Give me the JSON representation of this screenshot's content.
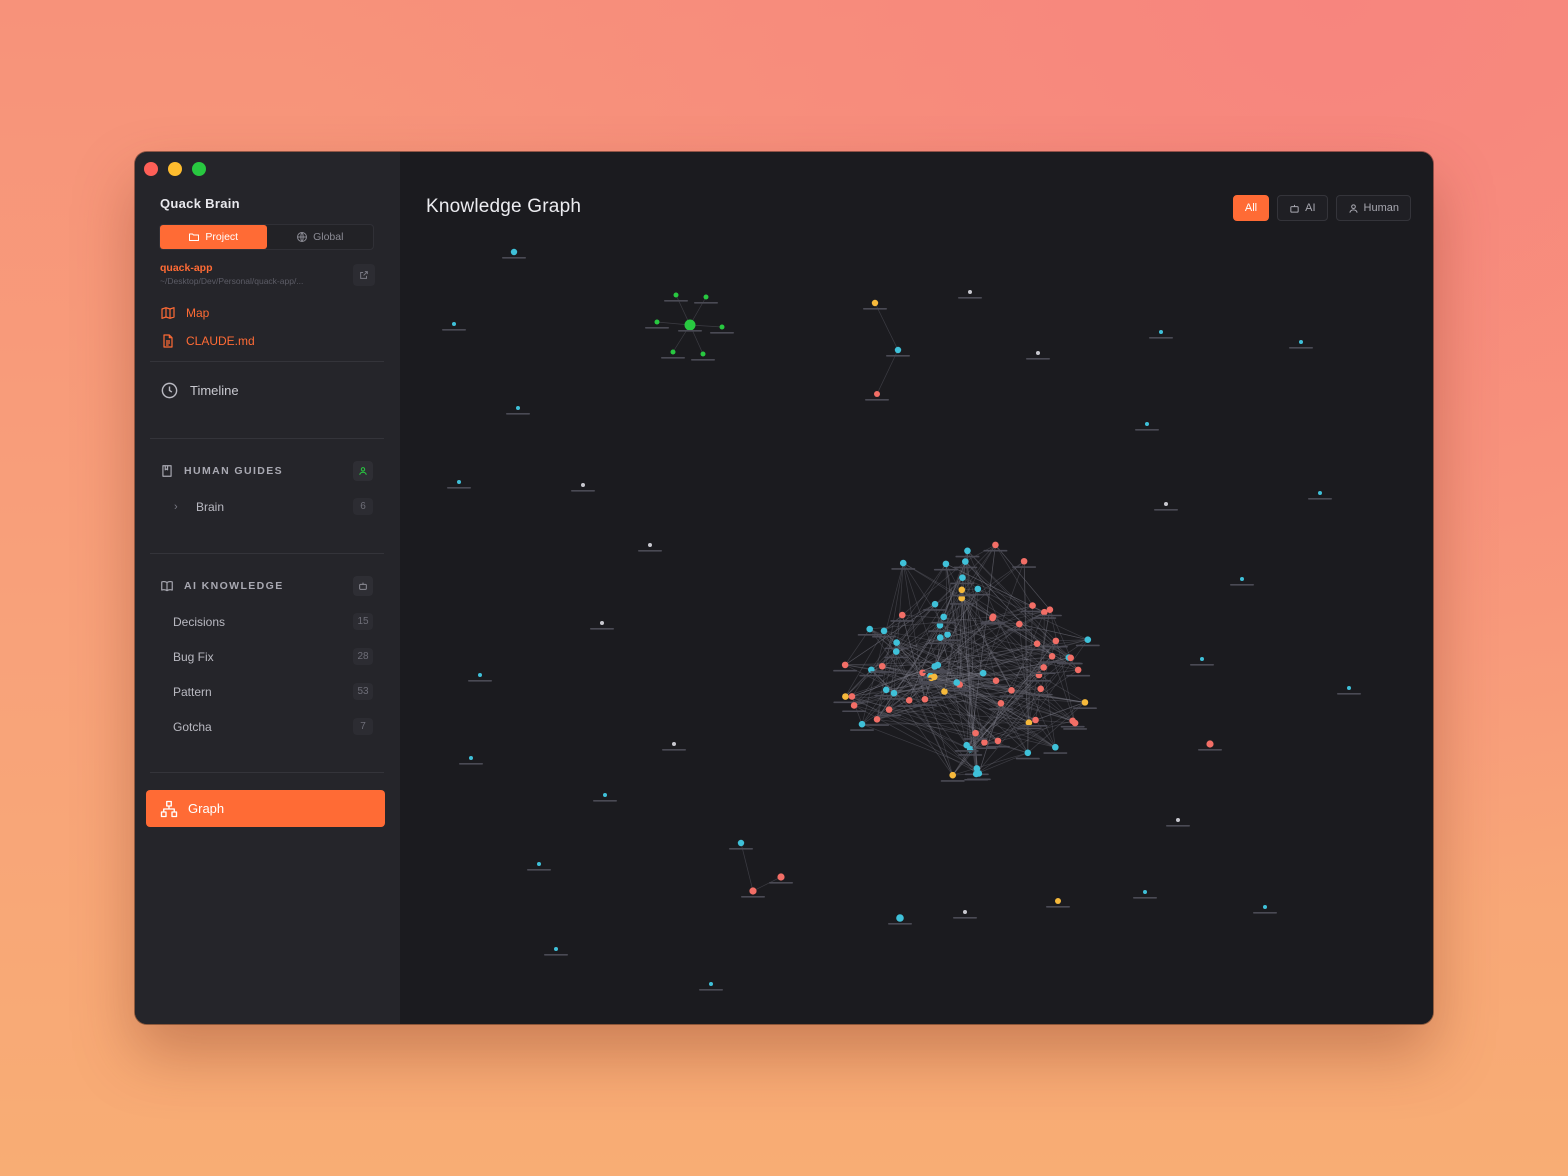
{
  "app": {
    "brand": "Quack Brain",
    "scope": {
      "project_label": "Project",
      "global_label": "Global"
    },
    "project": {
      "name": "quack-app",
      "path": "~/Desktop/Dev/Personal/quack-app/..."
    },
    "links": [
      {
        "label": "Map",
        "icon": "map-icon"
      },
      {
        "label": "CLAUDE.md",
        "icon": "file-icon"
      }
    ],
    "timeline_label": "Timeline",
    "human_guides": {
      "title": "HUMAN GUIDES",
      "items": [
        {
          "label": "Brain",
          "count": "6"
        }
      ]
    },
    "ai_knowledge": {
      "title": "AI KNOWLEDGE",
      "items": [
        {
          "label": "Decisions",
          "count": "15"
        },
        {
          "label": "Bug Fix",
          "count": "28"
        },
        {
          "label": "Pattern",
          "count": "53"
        },
        {
          "label": "Gotcha",
          "count": "7"
        }
      ]
    },
    "graph_label": "Graph"
  },
  "main": {
    "title": "Knowledge Graph",
    "filters": [
      {
        "label": "All",
        "active": true
      },
      {
        "label": "AI",
        "active": false,
        "icon": "robot-icon"
      },
      {
        "label": "Human",
        "active": false,
        "icon": "user-icon"
      }
    ]
  },
  "colors": {
    "accent": "#ff6b35",
    "node_cyan": "#3fc1d9",
    "node_red": "#f26e66",
    "node_yellow": "#f6b93b",
    "node_green": "#28c840",
    "node_grey": "#c8c8cf"
  }
}
